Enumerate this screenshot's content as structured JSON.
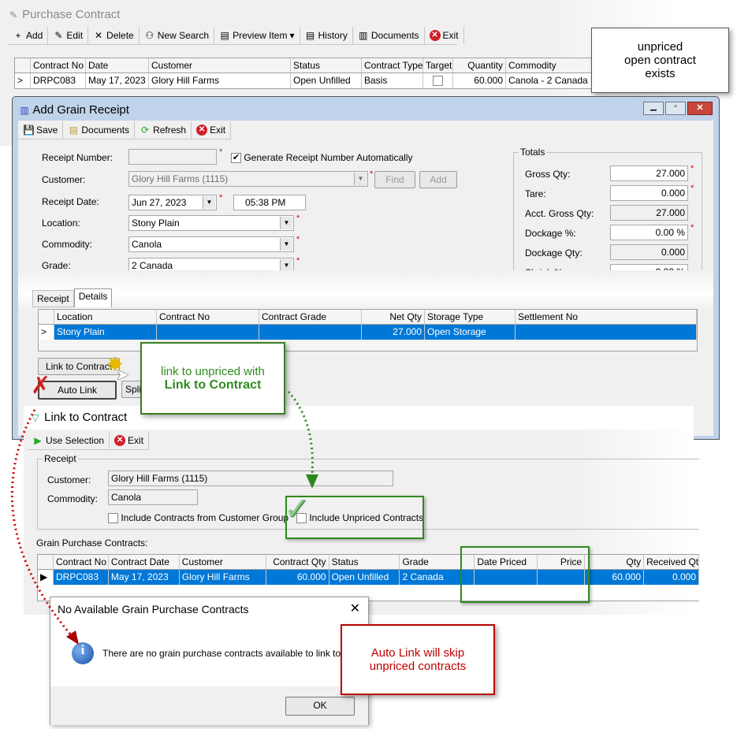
{
  "purchase_contract": {
    "title": "Purchase Contract",
    "toolbar": [
      {
        "icon": "plus-icon",
        "label": "Add"
      },
      {
        "icon": "pencil-icon",
        "label": "Edit"
      },
      {
        "icon": "x-icon",
        "label": "Delete"
      },
      {
        "icon": "binoculars-icon",
        "label": "New Search"
      },
      {
        "icon": "preview-icon",
        "label": "Preview Item"
      },
      {
        "icon": "history-icon",
        "label": "History"
      },
      {
        "icon": "documents-icon",
        "label": "Documents"
      },
      {
        "icon": "exit-icon",
        "label": "Exit"
      }
    ],
    "columns": [
      "Contract No",
      "Date",
      "Customer",
      "Status",
      "Contract Type",
      "Target",
      "Quantity",
      "Commodity"
    ],
    "rows": [
      [
        "DRPC083",
        "May 17, 2023",
        "Glory Hill Farms",
        "Open Unfilled",
        "Basis",
        "",
        "60.000",
        "Canola - 2 Canada"
      ]
    ]
  },
  "callout_top": [
    "unpriced",
    "open contract",
    "exists"
  ],
  "grain_receipt": {
    "title": "Add Grain Receipt",
    "toolbar": [
      "Save",
      "Documents",
      "Refresh",
      "Exit"
    ],
    "labels": {
      "receipt_number": "Receipt Number:",
      "customer": "Customer:",
      "receipt_date": "Receipt Date:",
      "location": "Location:",
      "commodity": "Commodity:",
      "grade": "Grade:"
    },
    "values": {
      "receipt_number": "",
      "customer": "Glory Hill Farms (1115)",
      "receipt_date": "Jun  27, 2023",
      "time": "05:38 PM",
      "location": "Stony Plain",
      "commodity": "Canola",
      "grade": "2 Canada"
    },
    "generate_auto": "Generate Receipt Number Automatically",
    "find": "Find",
    "add": "Add",
    "totals": {
      "title": "Totals",
      "items": [
        {
          "label": "Gross Qty:",
          "value": "27.000",
          "ro": false,
          "req": true
        },
        {
          "label": "Tare:",
          "value": "0.000",
          "ro": false,
          "req": true
        },
        {
          "label": "Acct. Gross Qty:",
          "value": "27.000",
          "ro": true,
          "req": false
        },
        {
          "label": "Dockage %:",
          "value": "0.00 %",
          "ro": false,
          "req": true
        },
        {
          "label": "Dockage Qty:",
          "value": "0.000",
          "ro": true,
          "req": false
        },
        {
          "label": "Shrink %:",
          "value": "0.00 %",
          "ro": false,
          "req": false
        }
      ]
    },
    "tabs": [
      "Receipt",
      "Details"
    ],
    "columns": [
      "Location",
      "Contract No",
      "Contract Grade",
      "Net Qty",
      "Storage Type",
      "Settlement No"
    ],
    "rows": [
      [
        "Stony Plain",
        "",
        "",
        "27.000",
        "Open Storage",
        ""
      ]
    ],
    "link_button": "Link to Contract",
    "auto_link": "Auto Link",
    "split": "Split"
  },
  "callout_green": {
    "line1": "link to unpriced with",
    "line2": "Link to Contract"
  },
  "link_contract": {
    "title": "Link to Contract",
    "toolbar": [
      "Use Selection",
      "Exit"
    ],
    "group": "Receipt",
    "customer_label": "Customer:",
    "customer": "Glory Hill Farms (1115)",
    "commodity_label": "Commodity:",
    "commodity": "Canola",
    "include_group": "Include Contracts from Customer Group",
    "include_unpriced": "Include Unpriced Contracts",
    "grid_label": "Grain Purchase Contracts:",
    "columns": [
      "Contract No",
      "Contract Date",
      "Customer",
      "Contract Qty",
      "Status",
      "Grade",
      "Date Priced",
      "Price",
      "Qty",
      "Received Qty"
    ],
    "rows": [
      [
        "DRPC083",
        "May 17, 2023",
        "Glory Hill Farms",
        "60.000",
        "Open Unfilled",
        "2 Canada",
        "",
        "",
        "60.000",
        "0.000"
      ]
    ]
  },
  "message": {
    "title": "No Available Grain Purchase Contracts",
    "text": "There are no grain purchase contracts available to link to.",
    "ok": "OK"
  },
  "callout_red": {
    "line1": "Auto Link will skip",
    "line2": "unpriced contracts"
  },
  "colors": {
    "selection": "#0078d7",
    "green": "#2e7d1e",
    "red": "#c00000"
  }
}
